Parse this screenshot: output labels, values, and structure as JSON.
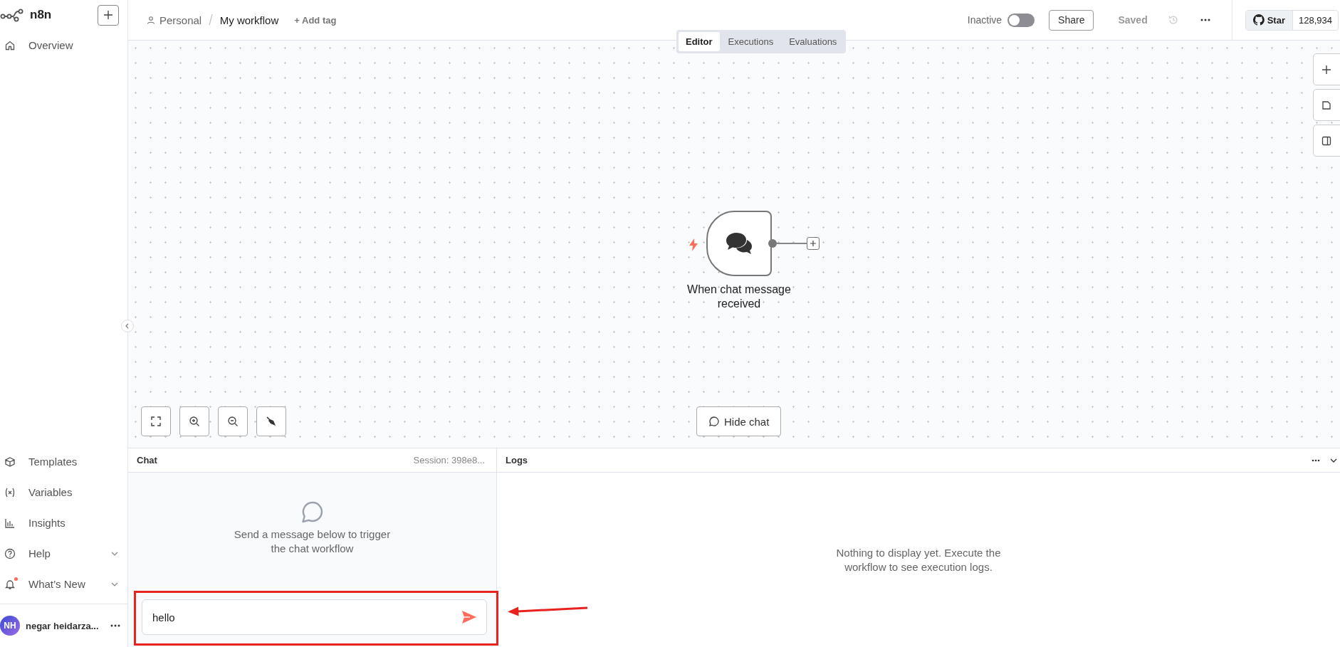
{
  "sidebar": {
    "logo": "n8n",
    "nav_top": [
      {
        "label": "Overview",
        "kind": "home",
        "selected": false
      }
    ],
    "nav_bottom": [
      {
        "label": "Templates",
        "kind": "templates",
        "expandable": false,
        "notification": false
      },
      {
        "label": "Variables",
        "kind": "variables",
        "expandable": false,
        "notification": false
      },
      {
        "label": "Insights",
        "kind": "insights",
        "expandable": false,
        "notification": false
      },
      {
        "label": "Help",
        "kind": "help",
        "expandable": true,
        "notification": false
      },
      {
        "label": "What’s New",
        "kind": "bell",
        "expandable": true,
        "notification": true
      }
    ],
    "user": {
      "initials": "NH",
      "name": "negar heidarza..."
    }
  },
  "header": {
    "project": "Personal",
    "separator": "/",
    "workflow": "My workflow",
    "add_tag": "+ Add tag",
    "status": "Inactive",
    "active": false,
    "share": "Share",
    "save_state": "Saved",
    "github": {
      "label": "Star",
      "count": "128,934"
    }
  },
  "tabs": [
    {
      "label": "Editor",
      "selected": true
    },
    {
      "label": "Executions",
      "selected": false
    },
    {
      "label": "Evaluations",
      "selected": false
    }
  ],
  "canvas": {
    "nodes": [
      {
        "name": "When chat message received",
        "kind": "chat_trigger"
      }
    ],
    "hide_chat": "Hide chat"
  },
  "chat": {
    "title": "Chat",
    "session": "Session: 398e8...",
    "empty_text": "Send a message below to trigger the chat workflow",
    "input": {
      "value": "hello"
    }
  },
  "logs": {
    "title": "Logs",
    "empty_text": "Nothing to display yet. Execute the workflow to see execution logs."
  }
}
